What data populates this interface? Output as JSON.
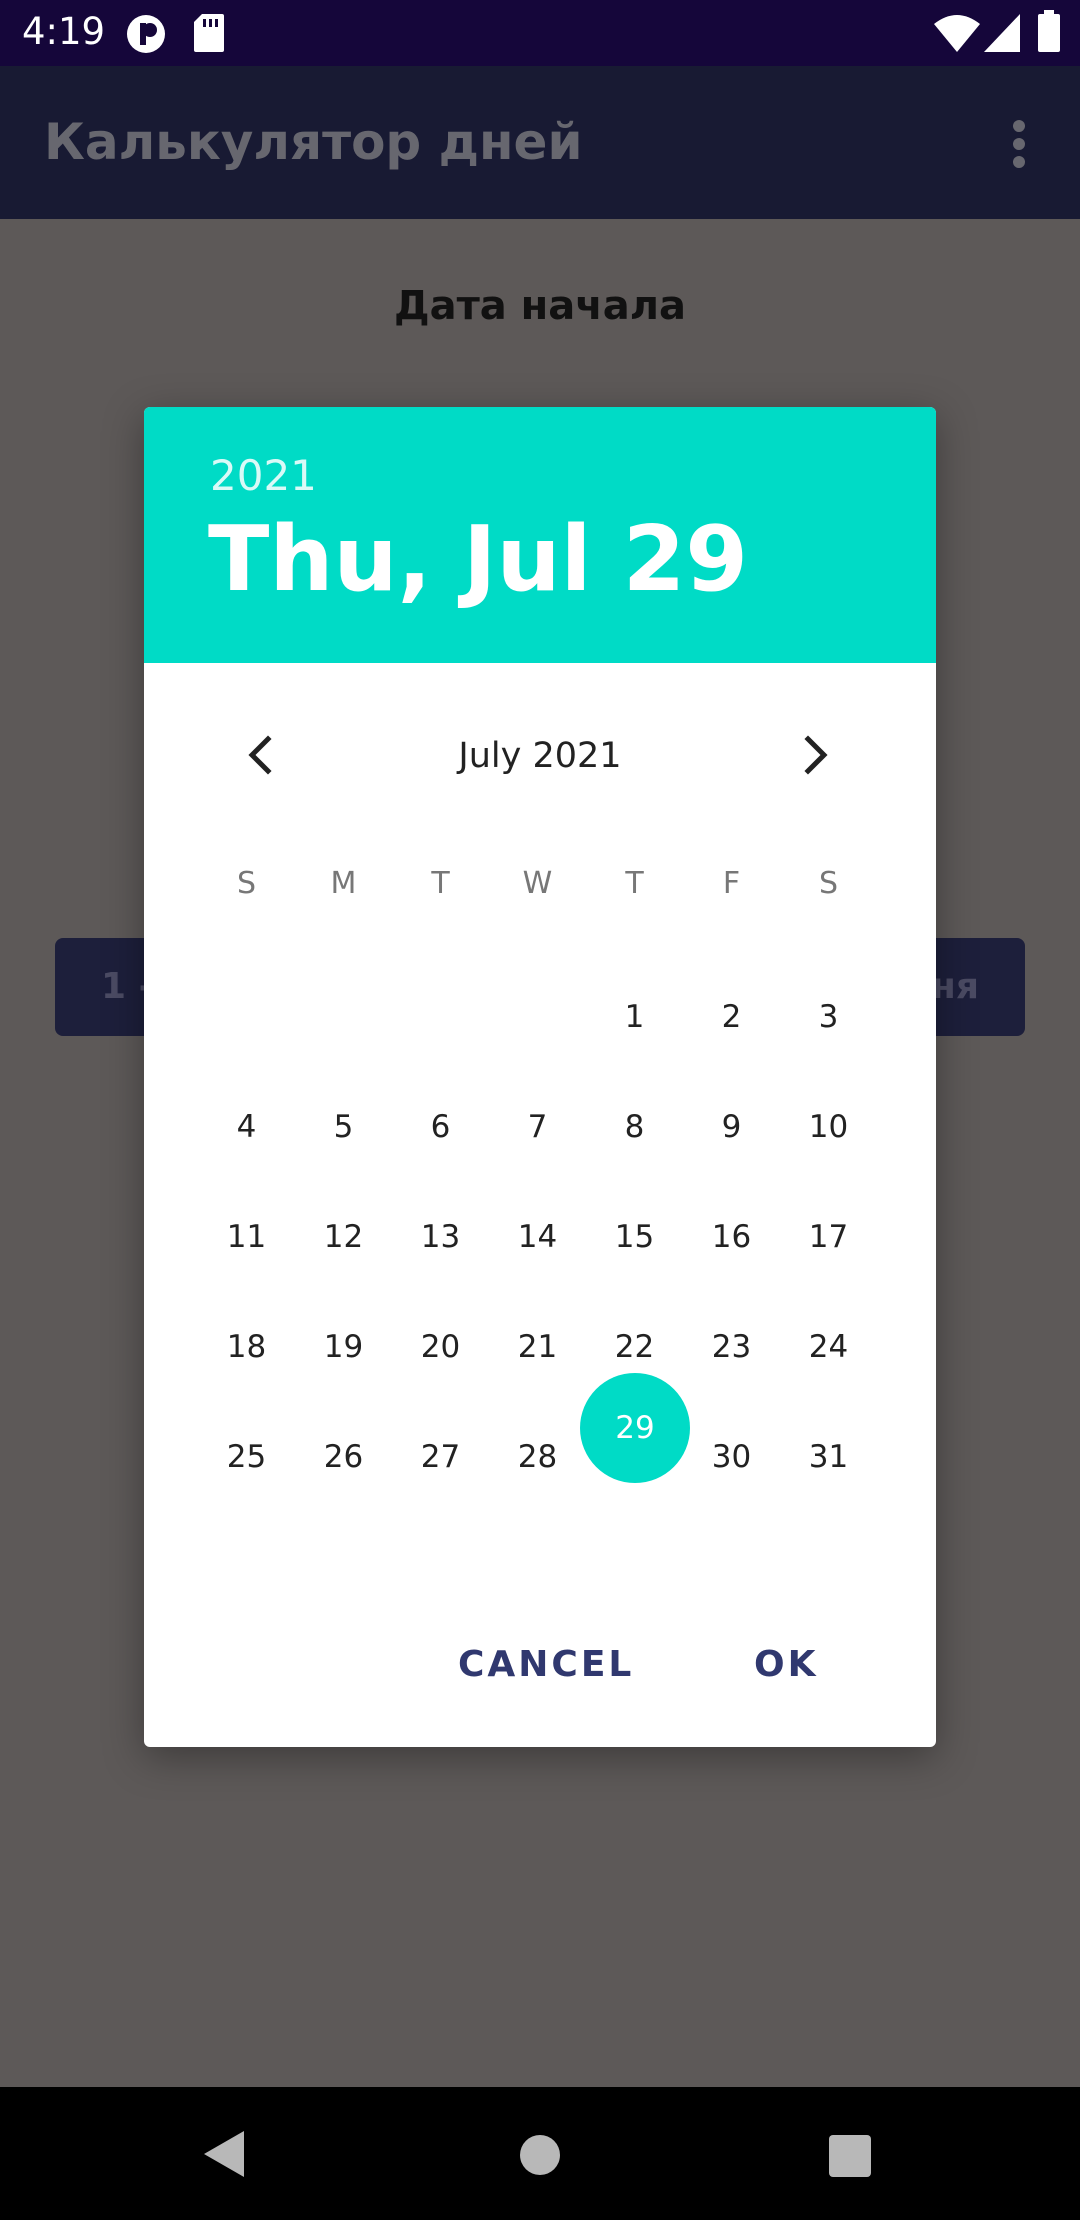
{
  "status_bar": {
    "time": "4:19"
  },
  "app_bar": {
    "title": "Калькулятор дней"
  },
  "background": {
    "start_label": "Дата начала",
    "button_left": "1 -",
    "button_right": "ня"
  },
  "dialog": {
    "header": {
      "year": "2021",
      "date": "Thu, Jul 29"
    },
    "month_label": "July 2021",
    "weekdays": [
      "S",
      "M",
      "T",
      "W",
      "T",
      "F",
      "S"
    ],
    "selected_day": "29",
    "cancel_label": "CANCEL",
    "ok_label": "OK"
  },
  "colors": {
    "accent": "#00dbc6",
    "button_text": "#30386f",
    "status_bar": "#15063a",
    "scrim_background": "#5d5958"
  }
}
